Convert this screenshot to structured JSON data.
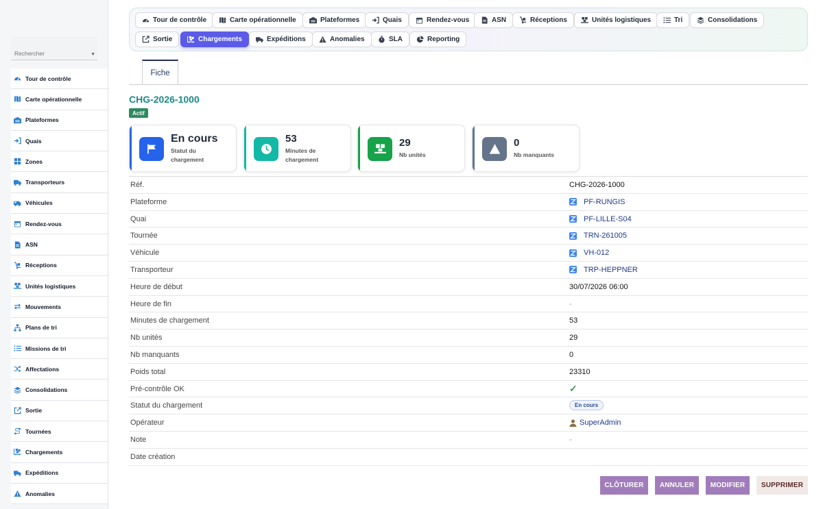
{
  "sidebar": {
    "search_placeholder": "Rechercher",
    "items": [
      {
        "label": "Tour de contrôle",
        "icon": "gauge-icon"
      },
      {
        "label": "Carte opérationnelle",
        "icon": "map-icon"
      },
      {
        "label": "Plateformes",
        "icon": "warehouse-icon"
      },
      {
        "label": "Quais",
        "icon": "dock-in-icon"
      },
      {
        "label": "Zones",
        "icon": "grid-icon"
      },
      {
        "label": "Transporteurs",
        "icon": "truck-icon"
      },
      {
        "label": "Véhicules",
        "icon": "van-icon"
      },
      {
        "label": "Rendez-vous",
        "icon": "calendar-icon"
      },
      {
        "label": "ASN",
        "icon": "document-icon"
      },
      {
        "label": "Réceptions",
        "icon": "dolly-icon"
      },
      {
        "label": "Unités logistiques",
        "icon": "pallet-icon"
      },
      {
        "label": "Mouvements",
        "icon": "arrows-icon"
      },
      {
        "label": "Plans de tri",
        "icon": "sitemap-icon"
      },
      {
        "label": "Missions de tri",
        "icon": "list-icon"
      },
      {
        "label": "Affectations",
        "icon": "shuffle-icon"
      },
      {
        "label": "Consolidations",
        "icon": "layers-icon"
      },
      {
        "label": "Sortie",
        "icon": "exit-icon"
      },
      {
        "label": "Tournées",
        "icon": "route-icon"
      },
      {
        "label": "Chargements",
        "icon": "loading-icon"
      },
      {
        "label": "Expéditions",
        "icon": "shipping-icon"
      },
      {
        "label": "Anomalies",
        "icon": "warning-icon"
      }
    ]
  },
  "tabs": [
    {
      "label": "Tour de contrôle",
      "icon": "gauge-icon"
    },
    {
      "label": "Carte opérationnelle",
      "icon": "map-icon"
    },
    {
      "label": "Plateformes",
      "icon": "warehouse-icon"
    },
    {
      "label": "Quais",
      "icon": "dock-in-icon"
    },
    {
      "label": "Rendez-vous",
      "icon": "calendar-icon"
    },
    {
      "label": "ASN",
      "icon": "document-icon"
    },
    {
      "label": "Réceptions",
      "icon": "dolly-icon"
    },
    {
      "label": "Unités logistiques",
      "icon": "pallet-icon"
    },
    {
      "label": "Tri",
      "icon": "list-icon"
    },
    {
      "label": "Consolidations",
      "icon": "layers-icon"
    },
    {
      "label": "Sortie",
      "icon": "exit-icon"
    },
    {
      "label": "Chargements",
      "icon": "loading-icon",
      "active": true
    },
    {
      "label": "Expéditions",
      "icon": "shipping-icon"
    },
    {
      "label": "Anomalies",
      "icon": "warning-icon"
    },
    {
      "label": "SLA",
      "icon": "stopwatch-icon"
    },
    {
      "label": "Reporting",
      "icon": "pie-icon"
    }
  ],
  "form_tab": "Fiche",
  "record": {
    "title": "CHG-2026-1000",
    "status_badge": "Actif"
  },
  "cards": [
    {
      "value": "En cours",
      "label": "Statut du chargement",
      "icon": "flag-icon",
      "color": "#2563eb"
    },
    {
      "value": "53",
      "label": "Minutes de chargement",
      "icon": "clock-icon",
      "color": "#14b8a6"
    },
    {
      "value": "29",
      "label": "Nb unités",
      "icon": "pallet-icon",
      "color": "#16a34a"
    },
    {
      "value": "0",
      "label": "Nb manquants",
      "icon": "warning-icon",
      "color": "#64748b"
    }
  ],
  "fields": [
    {
      "label": "Réf.",
      "value": "CHG-2026-1000",
      "type": "text"
    },
    {
      "label": "Plateforme",
      "value": "PF-RUNGIS",
      "type": "link"
    },
    {
      "label": "Quai",
      "value": "PF-LILLE-S04",
      "type": "link"
    },
    {
      "label": "Tournée",
      "value": "TRN-261005",
      "type": "link"
    },
    {
      "label": "Véhicule",
      "value": "VH-012",
      "type": "link"
    },
    {
      "label": "Transporteur",
      "value": "TRP-HEPPNER",
      "type": "link"
    },
    {
      "label": "Heure de début",
      "value": "30/07/2026 06:00",
      "type": "text"
    },
    {
      "label": "Heure de fin",
      "value": "-",
      "type": "dash"
    },
    {
      "label": "Minutes de chargement",
      "value": "53",
      "type": "text"
    },
    {
      "label": "Nb unités",
      "value": "29",
      "type": "text"
    },
    {
      "label": "Nb manquants",
      "value": "0",
      "type": "text"
    },
    {
      "label": "Poids total",
      "value": "23310",
      "type": "text"
    },
    {
      "label": "Pré-contrôle OK",
      "value": "✓",
      "type": "check"
    },
    {
      "label": "Statut du chargement",
      "value": "En cours",
      "type": "pill"
    },
    {
      "label": "Opérateur",
      "value": "SuperAdmin",
      "type": "user"
    },
    {
      "label": "Note",
      "value": "-",
      "type": "dash"
    },
    {
      "label": "Date création",
      "value": "",
      "type": "text"
    }
  ],
  "actions": {
    "close": "CLÔTURER",
    "cancel": "ANNULER",
    "edit": "MODIFIER",
    "delete": "SUPPRIMER"
  },
  "colors": {
    "accent": "#5b5be8",
    "title": "#1b8a86",
    "badge": "#2e8a60",
    "action": "#a17cba",
    "link": "#1e3a8a"
  }
}
